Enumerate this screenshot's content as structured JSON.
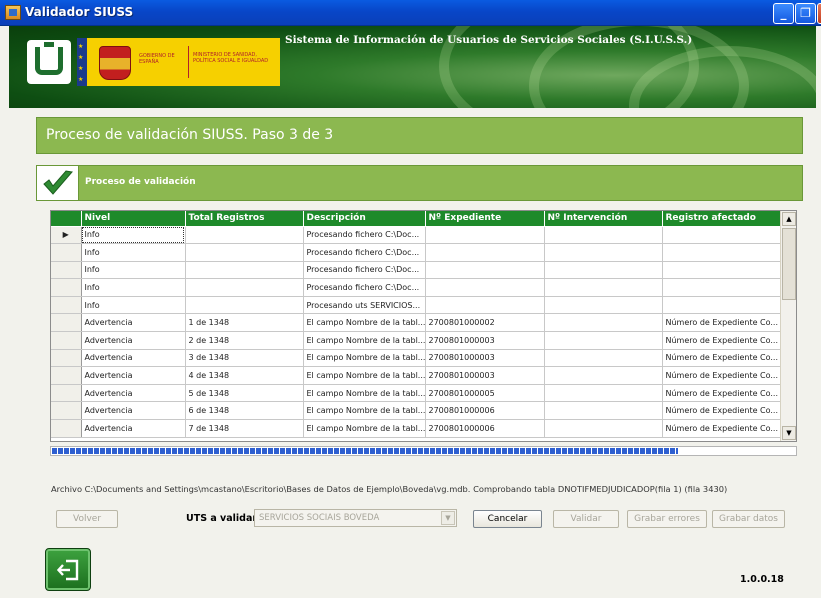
{
  "window": {
    "title": "Validador SIUSS"
  },
  "banner": {
    "government": "GOBIERNO DE ESPAÑA",
    "ministry": "MINISTERIO DE SANIDAD, POLÍTICA SOCIAL E IGUALDAD",
    "system_name": "Sistema de Información de Usuarios de Servicios Sociales (S.I.U.S.S.)"
  },
  "step": {
    "title": "Proceso de validación SIUSS.  Paso 3 de 3"
  },
  "process": {
    "title": "Proceso de validación"
  },
  "grid": {
    "columns": [
      "Nivel",
      "Total Registros",
      "Descripción",
      "Nº Expediente",
      "Nº Intervención",
      "Registro afectado"
    ],
    "rows": [
      {
        "marker": "▶",
        "cells": [
          "Info",
          "",
          "Procesando fichero C:\\Doc...",
          "",
          "",
          ""
        ]
      },
      {
        "marker": "",
        "cells": [
          "Info",
          "",
          "Procesando fichero C:\\Doc...",
          "",
          "",
          ""
        ]
      },
      {
        "marker": "",
        "cells": [
          "Info",
          "",
          "Procesando fichero C:\\Doc...",
          "",
          "",
          ""
        ]
      },
      {
        "marker": "",
        "cells": [
          "Info",
          "",
          "Procesando fichero C:\\Doc...",
          "",
          "",
          ""
        ]
      },
      {
        "marker": "",
        "cells": [
          "Info",
          "",
          "Procesando uts SERVICIOS...",
          "",
          "",
          ""
        ]
      },
      {
        "marker": "",
        "cells": [
          "Advertencia",
          "1 de 1348",
          "El campo Nombre de la tabl...",
          "2700801000002",
          "",
          "Número de Expediente Co..."
        ]
      },
      {
        "marker": "",
        "cells": [
          "Advertencia",
          "2 de 1348",
          "El campo Nombre de la tabl...",
          "2700801000003",
          "",
          "Número de Expediente Co..."
        ]
      },
      {
        "marker": "",
        "cells": [
          "Advertencia",
          "3 de 1348",
          "El campo Nombre de la tabl...",
          "2700801000003",
          "",
          "Número de Expediente Co..."
        ]
      },
      {
        "marker": "",
        "cells": [
          "Advertencia",
          "4 de 1348",
          "El campo Nombre de la tabl...",
          "2700801000003",
          "",
          "Número de Expediente Co..."
        ]
      },
      {
        "marker": "",
        "cells": [
          "Advertencia",
          "5 de 1348",
          "El campo Nombre de la tabl...",
          "2700801000005",
          "",
          "Número de Expediente Co..."
        ]
      },
      {
        "marker": "",
        "cells": [
          "Advertencia",
          "6 de 1348",
          "El campo Nombre de la tabl...",
          "2700801000006",
          "",
          "Número de Expediente Co..."
        ]
      },
      {
        "marker": "",
        "cells": [
          "Advertencia",
          "7 de 1348",
          "El campo Nombre de la tabl...",
          "2700801000006",
          "",
          "Número de Expediente Co..."
        ]
      }
    ]
  },
  "progress": {
    "fraction": 0.84
  },
  "status": {
    "text": "Archivo C:\\Documents and Settings\\mcastano\\Escritorio\\Bases de Datos de Ejemplo\\Boveda\\vg.mdb.  Comprobando tabla DNOTIFMEDJUDICADOP(fila 1) (fila 3430)"
  },
  "controls": {
    "volver": "Volver",
    "uts_label": "UTS a validar",
    "uts_value": "SERVICIOS SOCIAIS BOVEDA",
    "cancelar": "Cancelar",
    "validar": "Validar",
    "grabar_errores": "Grabar errores",
    "grabar_datos": "Grabar datos"
  },
  "footer": {
    "version": "1.0.0.18"
  },
  "colors": {
    "accent_green": "#8CB850",
    "grid_header": "#1E8A2A",
    "progress": "#2E5FD0"
  },
  "icons": {
    "step_check": "checkmark-icon",
    "exit": "exit-door-icon"
  }
}
